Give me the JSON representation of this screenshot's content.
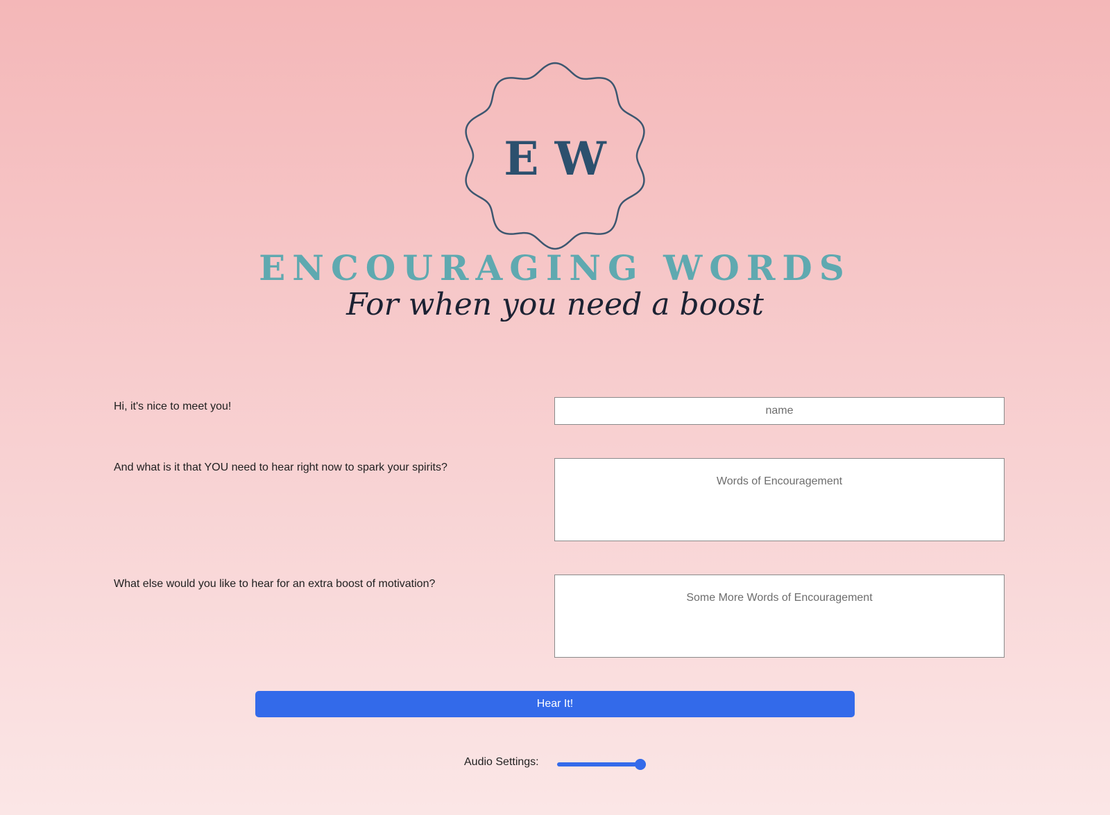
{
  "header": {
    "logo_monogram": "E W",
    "title": "ENCOURAGING WORDS",
    "tagline": "For when you need a boost"
  },
  "form": {
    "name_prompt": "Hi, it's nice to meet you!",
    "name_placeholder": "name",
    "words_prompt": "And what is it that YOU need to hear right now to spark your spirits?",
    "words_placeholder": "Words of Encouragement",
    "more_prompt": "What else would you like to hear for an extra boost of motivation?",
    "more_placeholder": "Some More Words of Encouragement",
    "submit_label": "Hear It!"
  },
  "audio": {
    "label": "Audio Settings:",
    "volume": 1.0
  },
  "colors": {
    "accent": "#336aea",
    "brand_teal": "#5fa9b0",
    "brand_navy": "#2c506e"
  }
}
